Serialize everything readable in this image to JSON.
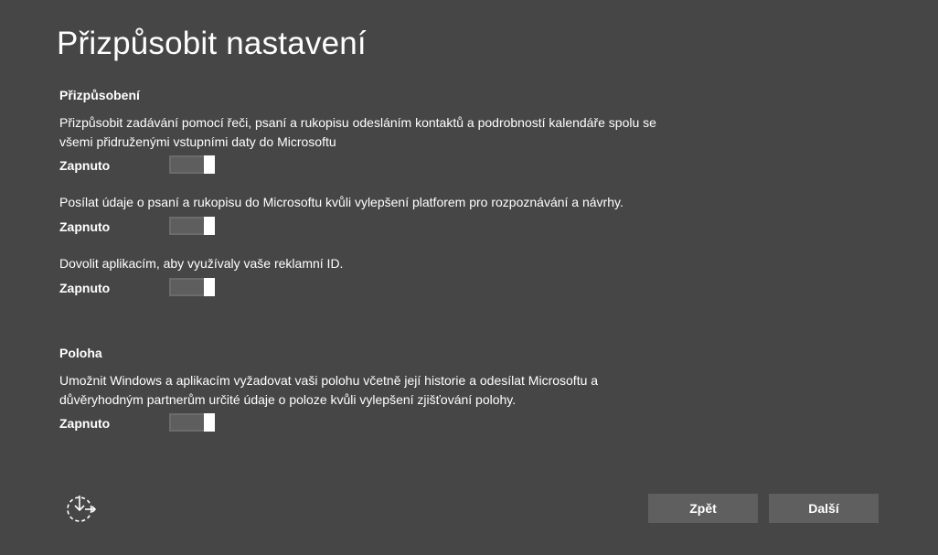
{
  "title": "Přizpůsobit nastavení",
  "sections": [
    {
      "heading": "Přizpůsobení",
      "settings": [
        {
          "description": "Přizpůsobit zadávání pomocí řeči, psaní a rukopisu odesláním kontaktů a podrobností kalendáře spolu se všemi přidruženými vstupními daty do Microsoftu",
          "state_label": "Zapnuto",
          "enabled": true
        },
        {
          "description": "Posílat údaje o psaní a rukopisu do Microsoftu kvůli vylepšení platforem pro rozpoznávání a návrhy.",
          "state_label": "Zapnuto",
          "enabled": true
        },
        {
          "description": "Dovolit aplikacím, aby využívaly vaše reklamní ID.",
          "state_label": "Zapnuto",
          "enabled": true
        }
      ]
    },
    {
      "heading": "Poloha",
      "settings": [
        {
          "description": "Umožnit Windows a aplikacím vyžadovat vaši polohu včetně její historie a odesílat Microsoftu a důvěryhodným partnerům určité údaje o poloze kvůli vylepšení zjišťování polohy.",
          "state_label": "Zapnuto",
          "enabled": true
        }
      ]
    }
  ],
  "footer": {
    "accessibility_icon": "ease-of-access-icon",
    "back_label": "Zpět",
    "next_label": "Další"
  },
  "colors": {
    "background": "#464646",
    "button": "#5f5f5f",
    "toggle_track": "#5e5e5e",
    "text": "#ffffff"
  }
}
